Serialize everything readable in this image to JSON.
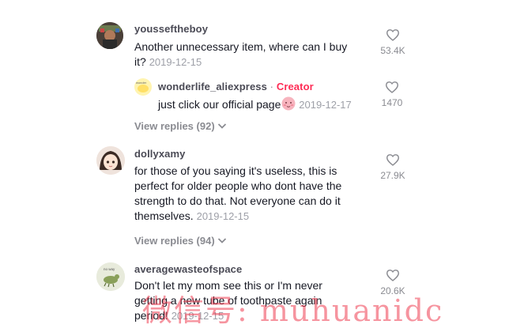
{
  "comments": [
    {
      "username": "youssef​theboy",
      "text": "Another unnecessary item, where can I buy it?",
      "text_line1": "Another unnecessary item, where can I buy",
      "text_line2": "it?",
      "date": "2019-12-15",
      "likes": "53.4K",
      "avatar_icon": "avatar-photo-icon",
      "reply": {
        "username": "wonderlife_aliexpress",
        "separator": "·",
        "badge": "Creator",
        "text": "just click our official page",
        "emoji_icon": "blushing-face-icon",
        "date": "2019-12-17",
        "likes": "1470"
      },
      "view_replies": "View replies (92)"
    },
    {
      "username": "dollyxamy",
      "text_lines": [
        "for those of you saying it's useless, this is",
        "perfect for older people who dont have the",
        "strength to do that. Not everyone can do it",
        "themselves."
      ],
      "date": "2019-12-15",
      "likes": "27.9K",
      "avatar_icon": "anime-avatar-icon",
      "view_replies": "View replies (94)"
    },
    {
      "username": "averagewasteofspace",
      "text_lines": [
        "Don't let my mom see this or I'm never",
        "getting a new tube of toothpaste again",
        "period!"
      ],
      "date": "2019-12-15",
      "likes": "20.6K",
      "avatar_icon": "cartoon-avatar-icon"
    }
  ],
  "icons": {
    "like": "heart-outline-icon",
    "expand": "chevron-down-icon"
  },
  "watermark": "微信号: muhuanidc",
  "colors": {
    "creator": "#fe2c55",
    "muted": "#8a8b91",
    "text": "#161823",
    "watermark": "#ee3c50"
  }
}
